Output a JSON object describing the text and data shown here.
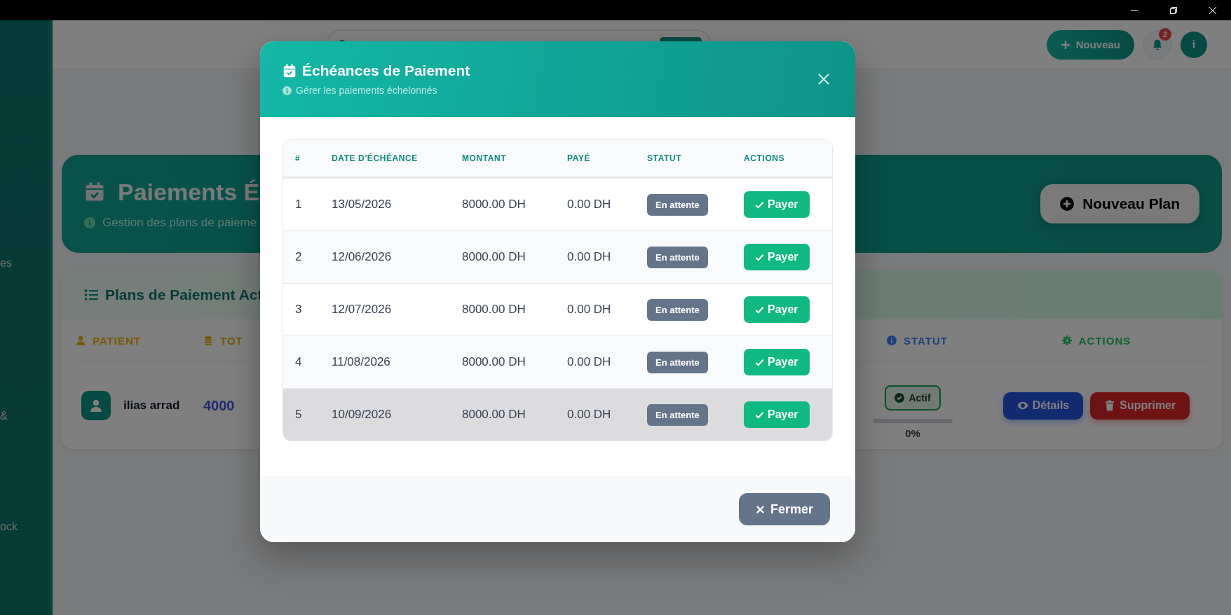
{
  "sidebar": {
    "items": [
      {
        "label": "es"
      },
      {
        "label": "&"
      },
      {
        "label": "ock"
      }
    ]
  },
  "header": {
    "new_button": "Nouveau",
    "notification_count": "2",
    "avatar": "i"
  },
  "hero": {
    "title": "Paiements É",
    "subtitle": "Gestion des plans de paieme",
    "button": "Nouveau Plan"
  },
  "plans": {
    "title": "Plans de Paiement Act",
    "columns": [
      {
        "label": "PATIENT",
        "kind": "patient"
      },
      {
        "label": "TOT",
        "kind": "total"
      },
      {
        "label": "STATUT",
        "kind": "status"
      },
      {
        "label": "ACTIONS",
        "kind": "actions"
      }
    ],
    "rows": [
      {
        "patient": "ilias arrad",
        "total": "4000",
        "status": "Actif",
        "level": 0,
        "progress": "0%",
        "actions": [
          {
            "label": "Détails",
            "kind": "view"
          },
          {
            "label": "Supprimer",
            "kind": "delete"
          }
        ]
      }
    ]
  },
  "modal": {
    "title": "Échéances de Paiement",
    "subtitle": "Gérer les paiements échelonnés",
    "columns": [
      "#",
      "DATE D'ÉCHÉANCE",
      "MONTANT",
      "PAYÉ",
      "STATUT",
      "ACTIONS"
    ],
    "rows": [
      {
        "index": "1",
        "due_date": "13/05/2026",
        "amount": "8000.00 DH",
        "paid": "0.00 DH",
        "status": "En attente",
        "action": "Payer",
        "highlighted": false
      },
      {
        "index": "2",
        "due_date": "12/06/2026",
        "amount": "8000.00 DH",
        "paid": "0.00 DH",
        "status": "En attente",
        "action": "Payer",
        "highlighted": false
      },
      {
        "index": "3",
        "due_date": "12/07/2026",
        "amount": "8000.00 DH",
        "paid": "0.00 DH",
        "status": "En attente",
        "action": "Payer",
        "highlighted": false
      },
      {
        "index": "4",
        "due_date": "11/08/2026",
        "amount": "8000.00 DH",
        "paid": "0.00 DH",
        "status": "En attente",
        "action": "Payer",
        "highlighted": false
      },
      {
        "index": "5",
        "due_date": "10/09/2026",
        "amount": "8000.00 DH",
        "paid": "0.00 DH",
        "status": "En attente",
        "action": "Payer",
        "highlighted": true
      }
    ],
    "close_button": "Fermer"
  }
}
